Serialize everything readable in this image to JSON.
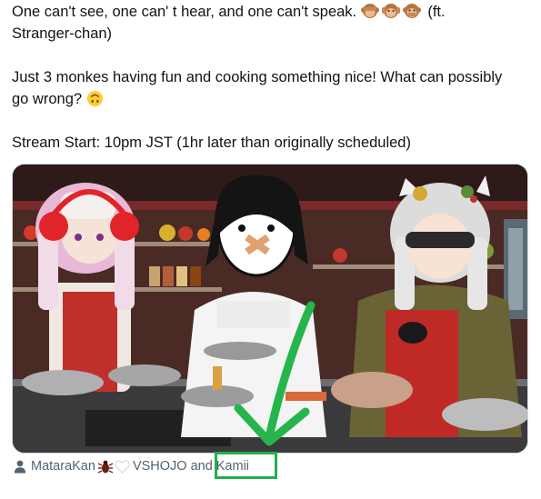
{
  "tweet": {
    "para1_text": "One can't see, one can' t hear, and one can't speak.",
    "para1_suffix": " (ft. Stranger-chan)",
    "para1_emojis": [
      "see-no-evil-monkey-icon",
      "hear-no-evil-monkey-icon",
      "speak-no-evil-monkey-icon"
    ],
    "para2_text": "Just 3 monkes having fun and cooking something nice! What can possibly go wrong?",
    "para2_emoji": "upside-down-face-icon",
    "para3_text": "Stream Start: 10pm JST (1hr later than originally scheduled)"
  },
  "media": {
    "annotation": "green-check-arrow-icon"
  },
  "tagline": {
    "person_icon": "person-icon",
    "user1": "MataraKan",
    "bug_icon": "bug-icon",
    "heart_icon": "white-heart-icon",
    "org": "VSHOJO",
    "and_text": "and",
    "user2": "Kamii"
  },
  "colors": {
    "text": "#0f1419",
    "muted": "#536471",
    "border": "#cfd9de",
    "highlight": "#1fb14a",
    "monkey": "#b5753f",
    "emoji_yellow": "#ffcc33"
  }
}
